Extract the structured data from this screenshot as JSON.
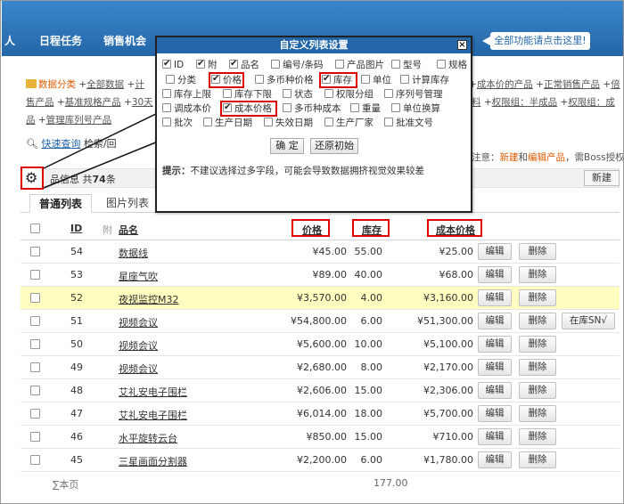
{
  "nav": {
    "items": [
      {
        "label": "人"
      },
      {
        "label": "日程任务"
      },
      {
        "label": "销售机会"
      }
    ],
    "tip": "全部功能请点击这里!"
  },
  "categories": {
    "row1": [
      "数据分类",
      "全部数据",
      "计",
      "成本价的产品",
      "正常销售产品",
      "倍"
    ],
    "row2": [
      "售产品",
      "基准规格产品",
      "30天",
      "料",
      "权限组：半成品",
      "权限组：成"
    ],
    "row3": [
      "品",
      "管理库列号产品"
    ]
  },
  "quick": {
    "label": "快速查询",
    "suffix": "检索/回"
  },
  "right_note": {
    "prefix": "注意：",
    "link1": "新建",
    "mid": "和",
    "link2": "编辑产品",
    "suffix": "，需Boss授权"
  },
  "infobar": {
    "prefix": "品信息 共",
    "count": "74",
    "suffix": "条",
    "new_label": "新建"
  },
  "tabs": [
    {
      "label": "普通列表"
    },
    {
      "label": "图片列表"
    }
  ],
  "table": {
    "headers": {
      "id": "ID",
      "attach": "附",
      "name": "品名",
      "price": "价格",
      "stock": "库存",
      "cost": "成本价格"
    },
    "edit_label": "编辑",
    "delete_label": "删除",
    "extra_label": "在库SN√",
    "rows": [
      {
        "id": "54",
        "name": "数据线",
        "price": "¥45.00",
        "stock": "55.00",
        "cost": "¥25.00"
      },
      {
        "id": "53",
        "name": "星座气吹",
        "price": "¥89.00",
        "stock": "40.00",
        "cost": "¥68.00"
      },
      {
        "id": "52",
        "name": "夜视监控M32",
        "price": "¥3,570.00",
        "stock": "4.00",
        "cost": "¥3,160.00"
      },
      {
        "id": "51",
        "name": "视频会议",
        "price": "¥54,800.00",
        "stock": "6.00",
        "cost": "¥51,300.00"
      },
      {
        "id": "50",
        "name": "视频会议",
        "price": "¥5,600.00",
        "stock": "10.00",
        "cost": "¥5,100.00"
      },
      {
        "id": "49",
        "name": "视频会议",
        "price": "¥2,680.00",
        "stock": "8.00",
        "cost": "¥2,170.00"
      },
      {
        "id": "48",
        "name": "艾礼安电子围栏",
        "price": "¥2,606.00",
        "stock": "15.00",
        "cost": "¥2,306.00"
      },
      {
        "id": "47",
        "name": "艾礼安电子围栏",
        "price": "¥6,014.00",
        "stock": "18.00",
        "cost": "¥5,700.00"
      },
      {
        "id": "46",
        "name": "水平旋转云台",
        "price": "¥850.00",
        "stock": "15.00",
        "cost": "¥710.00"
      },
      {
        "id": "45",
        "name": "三星画面分割器",
        "price": "¥2,200.00",
        "stock": "6.00",
        "cost": "¥1,780.00"
      }
    ],
    "footer": {
      "label": "∑本页",
      "total_stock": "177.00"
    }
  },
  "dialog": {
    "title": "自定义列表设置",
    "options": {
      "id": "ID",
      "attach": "附",
      "name": "品名",
      "code": "编号/条码",
      "image": "产品图片",
      "model": "型号",
      "spec": "规格",
      "category": "分类",
      "price": "价格",
      "multi_price": "多币种价格",
      "stock": "库存",
      "unit": "单位",
      "calc_stock": "计算库存",
      "stock_upper": "库存上限",
      "stock_lower": "库存下限",
      "status": "状态",
      "perm_group": "权限分组",
      "serial_mgmt": "序列号管理",
      "adjust_cost": "调成本价",
      "cost_price": "成本价格",
      "multi_cost": "多币种成本",
      "weight": "重量",
      "unit_conv": "单位换算",
      "batch": "批次",
      "prod_date": "生产日期",
      "expire_date": "失效日期",
      "manufacturer": "生产厂家",
      "approval": "批准文号"
    },
    "confirm_label": "确 定",
    "reset_label": "还原初始",
    "hint_bold": "提示：",
    "hint_text": "不建议选择过多字段，可能会导致数据拥挤视觉效果较差"
  }
}
